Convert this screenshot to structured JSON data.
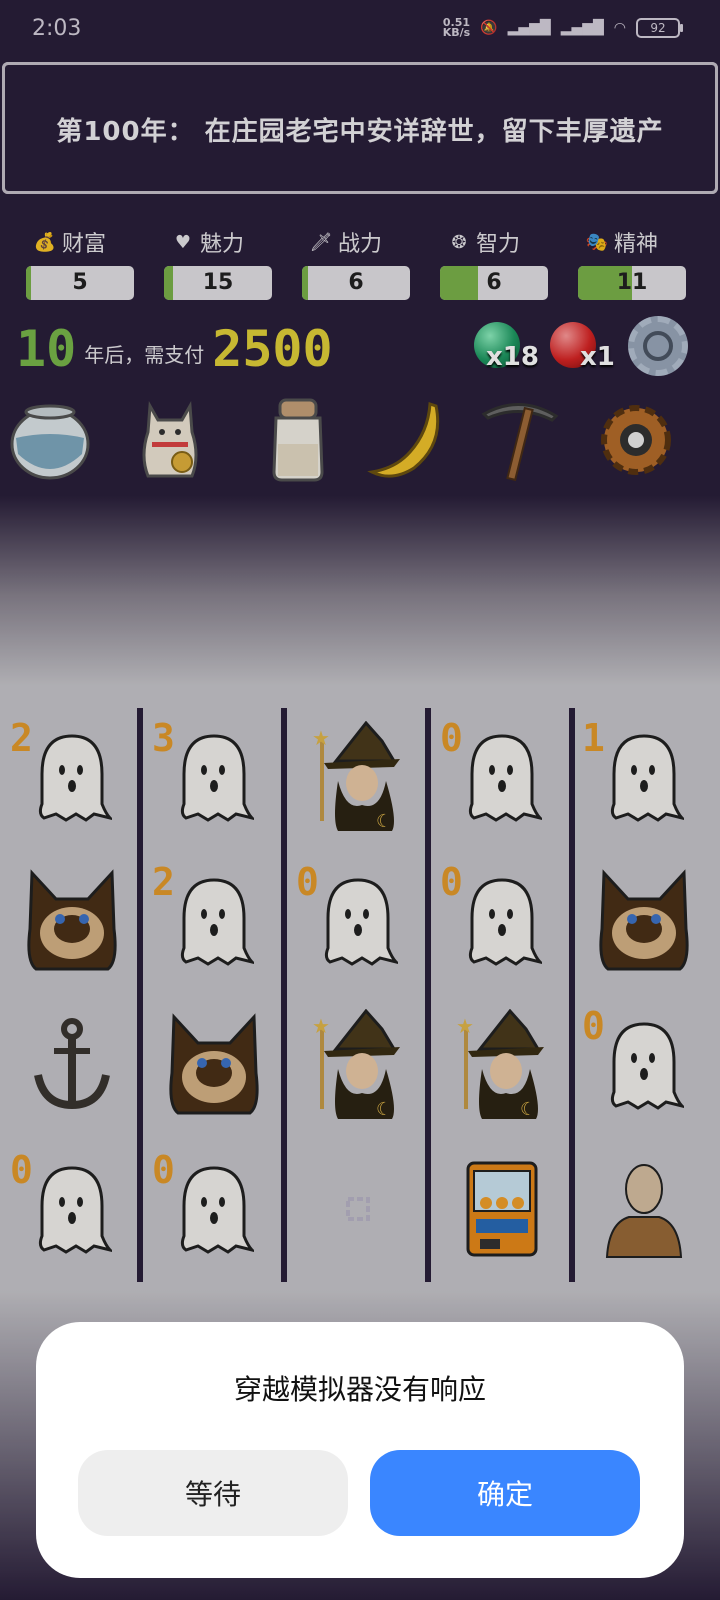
{
  "status": {
    "time": "2:03",
    "net_speed": "0.51\nKB/s",
    "battery": "92"
  },
  "banner": {
    "text": "第100年：  在庄园老宅中安详辞世，留下丰厚遗产"
  },
  "stats": [
    {
      "label": "财富",
      "icon": "money-bag-icon",
      "value": "5",
      "fill": 0.05
    },
    {
      "label": "魅力",
      "icon": "heart-icon",
      "value": "15",
      "fill": 0.08
    },
    {
      "label": "战力",
      "icon": "sword-icon",
      "value": "6",
      "fill": 0.06
    },
    {
      "label": "智力",
      "icon": "brain-icon",
      "value": "6",
      "fill": 0.35
    },
    {
      "label": "精神",
      "icon": "mask-icon",
      "value": "11",
      "fill": 0.5
    }
  ],
  "countdown": {
    "years": "10",
    "middle": "年后，需支付",
    "amount": "2500"
  },
  "orbs": {
    "green_count": "x18",
    "red_count": "x1"
  },
  "items": [
    "fishbowl-icon",
    "lucky-cat-icon",
    "salt-shaker-icon",
    "banana-icon",
    "pickaxe-icon",
    "cog-icon"
  ],
  "grid": {
    "columns": [
      [
        {
          "sym": "ghost",
          "num": "2"
        },
        {
          "sym": "cat",
          "num": ""
        },
        {
          "sym": "anchor",
          "num": ""
        },
        {
          "sym": "ghost",
          "num": "0"
        }
      ],
      [
        {
          "sym": "ghost",
          "num": "3"
        },
        {
          "sym": "ghost",
          "num": "2"
        },
        {
          "sym": "cat",
          "num": ""
        },
        {
          "sym": "ghost",
          "num": "0"
        }
      ],
      [
        {
          "sym": "witch",
          "num": ""
        },
        {
          "sym": "ghost",
          "num": "0"
        },
        {
          "sym": "witch",
          "num": ""
        },
        {
          "sym": "empty",
          "num": ""
        }
      ],
      [
        {
          "sym": "ghost",
          "num": "0"
        },
        {
          "sym": "ghost",
          "num": "0"
        },
        {
          "sym": "witch",
          "num": ""
        },
        {
          "sym": "claw-machine",
          "num": ""
        }
      ],
      [
        {
          "sym": "ghost",
          "num": "1"
        },
        {
          "sym": "cat",
          "num": ""
        },
        {
          "sym": "ghost",
          "num": "0"
        },
        {
          "sym": "person",
          "num": ""
        }
      ]
    ]
  },
  "dialog": {
    "title": "穿越模拟器没有响应",
    "wait_label": "等待",
    "ok_label": "确定"
  },
  "colors": {
    "bg": "#2a1f3b",
    "bar_fill": "#7bb34b",
    "years": "#79b84a",
    "amount": "#e3d23a",
    "number": "#e59b2b",
    "primary": "#3a86ff"
  }
}
